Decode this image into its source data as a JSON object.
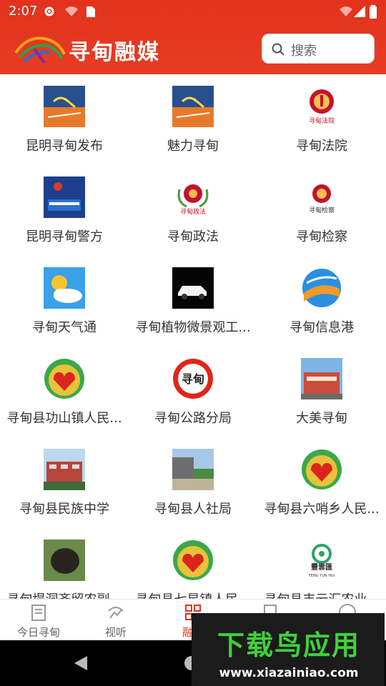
{
  "status_bar": {
    "time": "2:07"
  },
  "header": {
    "logo_text": "寻甸融媒",
    "search": {
      "placeholder": "搜索"
    }
  },
  "grid": {
    "items": [
      {
        "label": "昆明寻甸发布",
        "icon": "xundian-banner-thumb"
      },
      {
        "label": "魅力寻甸",
        "icon": "xundian-banner-thumb"
      },
      {
        "label": "寻甸法院",
        "icon": "court-emblem-icon",
        "caption": "寻甸法院"
      },
      {
        "label": "昆明寻甸警方",
        "icon": "police-thumb"
      },
      {
        "label": "寻甸政法",
        "icon": "politics-law-emblem-icon",
        "caption": "寻甸政法"
      },
      {
        "label": "寻甸检察",
        "icon": "procuratorate-emblem-icon",
        "caption": "寻甸检察"
      },
      {
        "label": "寻甸天气通",
        "icon": "weather-sun-cloud-icon"
      },
      {
        "label": "寻甸植物微景观工...",
        "icon": "car-photo-thumb"
      },
      {
        "label": "寻甸信息港",
        "icon": "info-port-globe-icon"
      },
      {
        "label": "寻甸县功山镇人民...",
        "icon": "handshake-heart-emblem-icon"
      },
      {
        "label": "寻甸公路分局",
        "icon": "highway-bureau-icon",
        "caption": "寻甸"
      },
      {
        "label": "大美寻甸",
        "icon": "building-photo-thumb"
      },
      {
        "label": "寻甸县民族中学",
        "icon": "school-photo-thumb"
      },
      {
        "label": "寻甸县人社局",
        "icon": "street-photo-thumb"
      },
      {
        "label": "寻甸县六哨乡人民...",
        "icon": "handshake-heart-emblem-icon"
      },
      {
        "label": "寻甸堤洞齐留农副...",
        "icon": "truffle-photo-thumb"
      },
      {
        "label": "寻甸县七星镇人民...",
        "icon": "handshake-heart-emblem-icon"
      },
      {
        "label": "寻甸县丰云汇农业...",
        "icon": "fengyunhui-logo-icon",
        "caption": "豐雲匯",
        "caption_en": "FENG YUN HUI"
      }
    ]
  },
  "bottom_nav": {
    "items": [
      {
        "label": "今日寻甸",
        "icon": "newspaper-icon",
        "active": false
      },
      {
        "label": "视听",
        "icon": "broadcast-icon",
        "active": false
      },
      {
        "label": "融媒",
        "icon": "grid-apps-icon",
        "active": true
      },
      {
        "label": "",
        "icon": "document-icon",
        "active": false
      },
      {
        "label": "",
        "icon": "profile-icon",
        "active": false
      }
    ]
  },
  "watermark": {
    "title": "下载鸟应用",
    "url": "www.xiazainiao.com"
  },
  "colors": {
    "brand_red": "#e2321d",
    "text": "#333333",
    "watermark_green": "#3fd13a"
  }
}
